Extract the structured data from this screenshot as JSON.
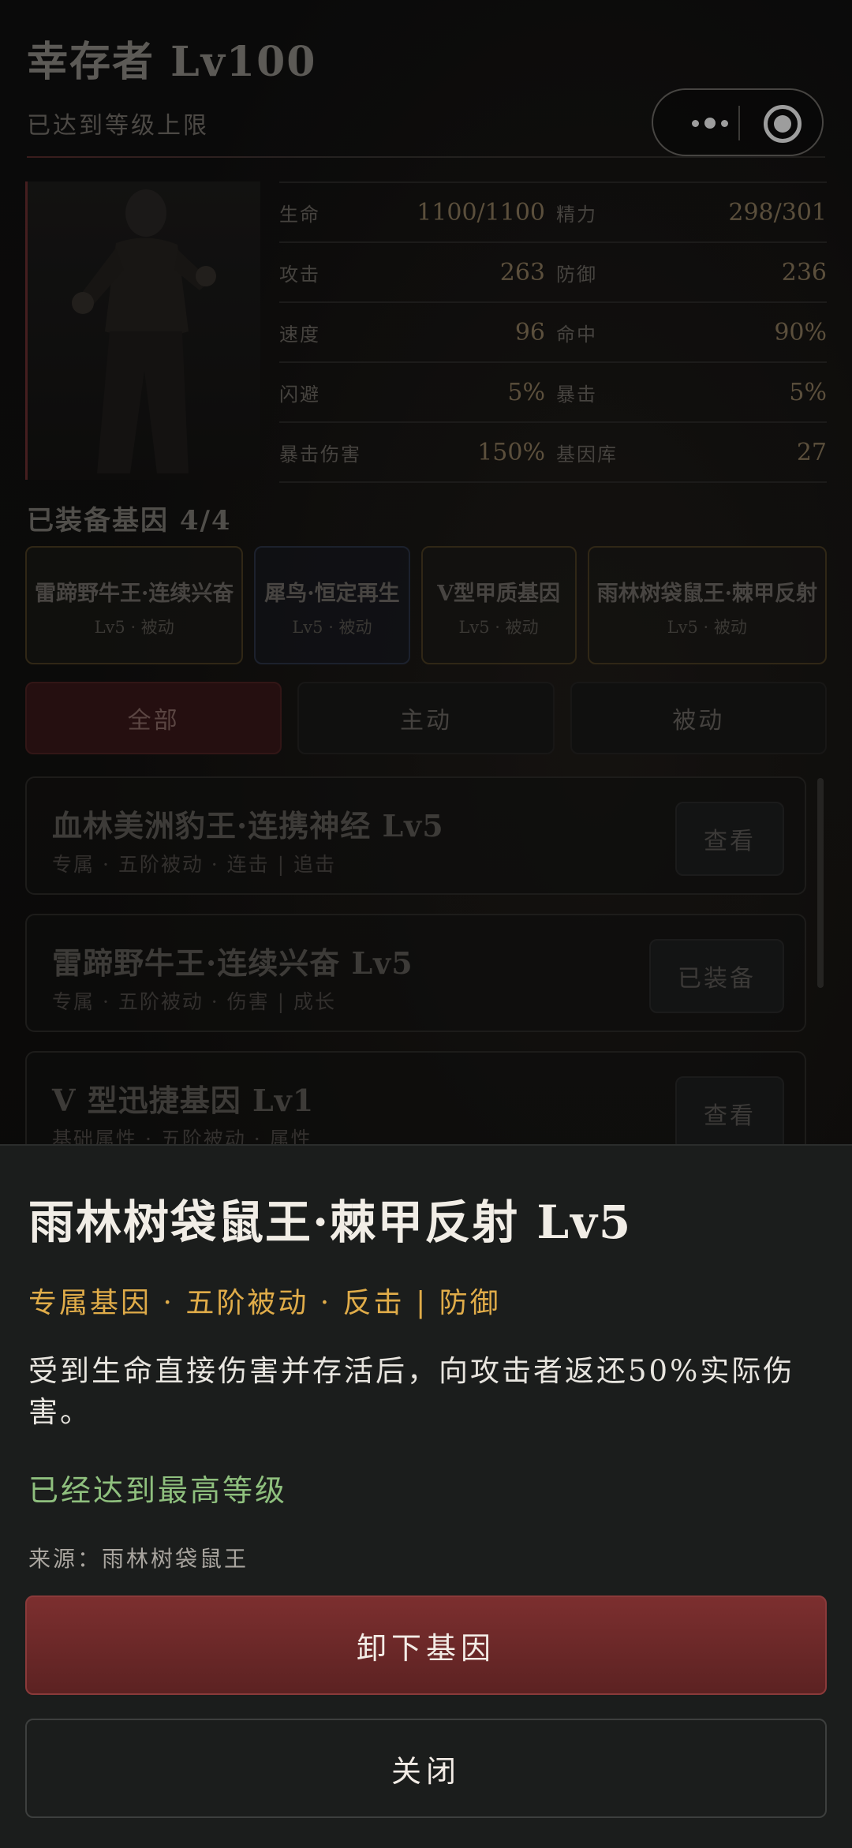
{
  "header": {
    "title": "幸存者 Lv100",
    "subtitle": "已达到等级上限",
    "capsule": {
      "more_icon": "more-dots-icon",
      "close_icon": "target-circle-icon"
    }
  },
  "stats": [
    {
      "left_label": "生命",
      "left_value": "1100/1100",
      "right_label": "精力",
      "right_value": "298/301"
    },
    {
      "left_label": "攻击",
      "left_value": "263",
      "right_label": "防御",
      "right_value": "236"
    },
    {
      "left_label": "速度",
      "left_value": "96",
      "right_label": "命中",
      "right_value": "90%"
    },
    {
      "left_label": "闪避",
      "left_value": "5%",
      "right_label": "暴击",
      "right_value": "5%"
    },
    {
      "left_label": "暴击伤害",
      "left_value": "150%",
      "right_label": "基因库",
      "right_value": "27"
    }
  ],
  "equipped": {
    "heading": "已装备基因 4/4",
    "items": [
      {
        "name": "雷蹄野牛王·连续兴奋",
        "sub": "Lv5 · 被动"
      },
      {
        "name": "犀鸟·恒定再生",
        "sub": "Lv5 · 被动"
      },
      {
        "name": "V型甲质基因",
        "sub": "Lv5 · 被动"
      },
      {
        "name": "雨林树袋鼠王·棘甲反射",
        "sub": "Lv5 · 被动"
      }
    ]
  },
  "filters": {
    "all": "全部",
    "active": "主动",
    "passive": "被动"
  },
  "genes": [
    {
      "name": "血林美洲豹王·连携神经 Lv5",
      "desc": "专属 · 五阶被动 · 连击 | 追击",
      "button": "查看"
    },
    {
      "name": "雷蹄野牛王·连续兴奋 Lv5",
      "desc": "专属 · 五阶被动 · 伤害 | 成长",
      "button": "已装备"
    },
    {
      "name": "V 型迅捷基因 Lv1",
      "desc": "基础属性 · 五阶被动 · 属性",
      "button": "查看"
    }
  ],
  "sheet": {
    "title": "雨林树袋鼠王·棘甲反射 Lv5",
    "tags": "专属基因 · 五阶被动 · 反击 | 防御",
    "description": "受到生命直接伤害并存活后，向攻击者返还50%实际伤害。",
    "max_level": "已经达到最高等级",
    "source": "来源：雨林树袋鼠王",
    "unequip_label": "卸下基因",
    "close_label": "关闭"
  },
  "colors": {
    "accent_gold": "#e0ac49",
    "max_green": "#8fc07e",
    "unequip_red": "#7c2f2f"
  }
}
